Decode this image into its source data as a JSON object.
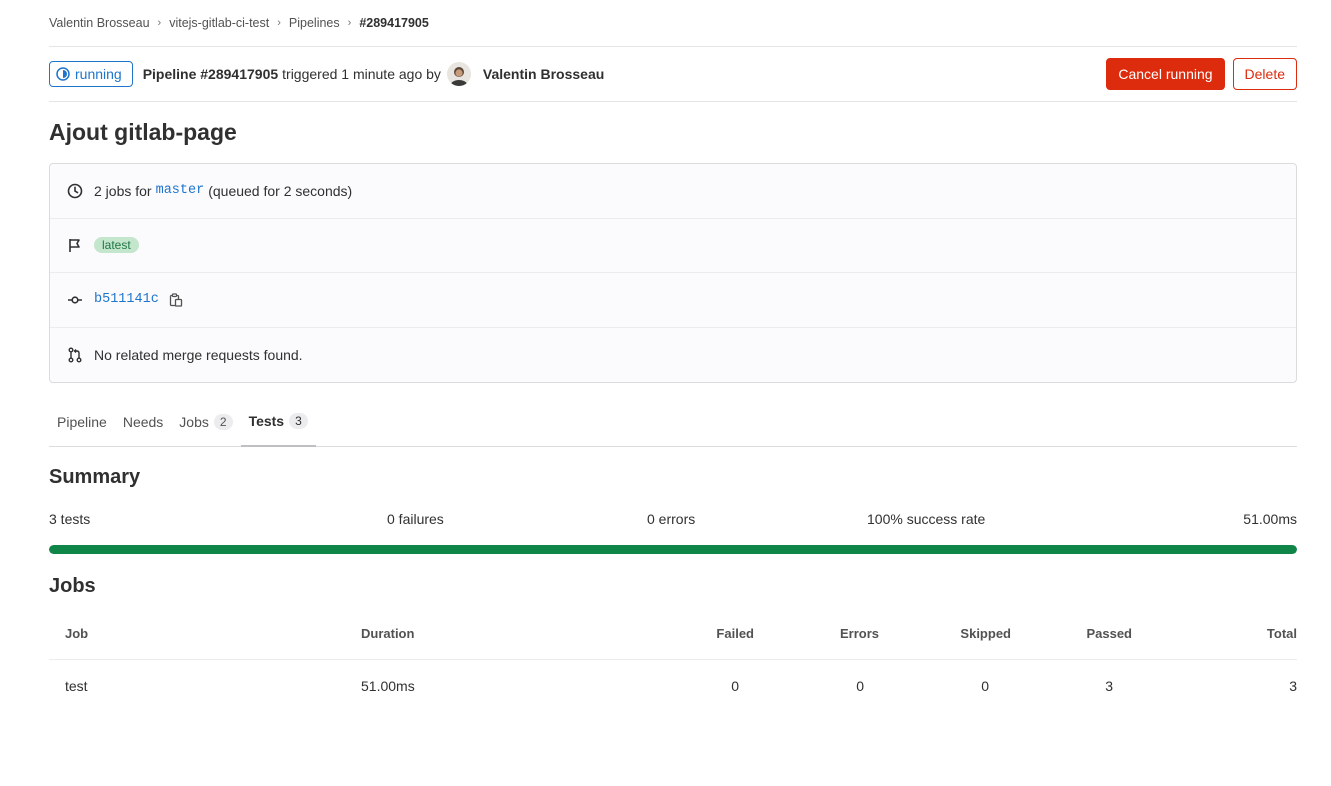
{
  "breadcrumb": [
    "Valentin Brosseau",
    "vitejs-gitlab-ci-test",
    "Pipelines",
    "#289417905"
  ],
  "header": {
    "status": "running",
    "pipeline_label": "Pipeline #289417905",
    "triggered_text": "triggered 1 minute ago by",
    "user": "Valentin Brosseau",
    "cancel_label": "Cancel running",
    "delete_label": "Delete"
  },
  "title": "Ajout gitlab-page",
  "info": {
    "jobs_prefix": "2 jobs for",
    "branch": "master",
    "queued": "(queued for 2 seconds)",
    "badge": "latest",
    "commit": "b511141c",
    "merge_requests": "No related merge requests found."
  },
  "tabs": [
    {
      "label": "Pipeline",
      "count": null
    },
    {
      "label": "Needs",
      "count": null
    },
    {
      "label": "Jobs",
      "count": "2"
    },
    {
      "label": "Tests",
      "count": "3",
      "active": true
    }
  ],
  "summary": {
    "heading": "Summary",
    "tests": "3 tests",
    "failures": "0 failures",
    "errors": "0 errors",
    "success_rate": "100% success rate",
    "duration": "51.00ms",
    "progress_percent": 100
  },
  "jobs": {
    "heading": "Jobs",
    "columns": [
      "Job",
      "Duration",
      "Failed",
      "Errors",
      "Skipped",
      "Passed",
      "Total"
    ],
    "rows": [
      {
        "job": "test",
        "duration": "51.00ms",
        "failed": "0",
        "errors": "0",
        "skipped": "0",
        "passed": "3",
        "total": "3"
      }
    ]
  },
  "colors": {
    "accent": "#1f75cb",
    "danger": "#dd2b0e",
    "success": "#108548"
  }
}
